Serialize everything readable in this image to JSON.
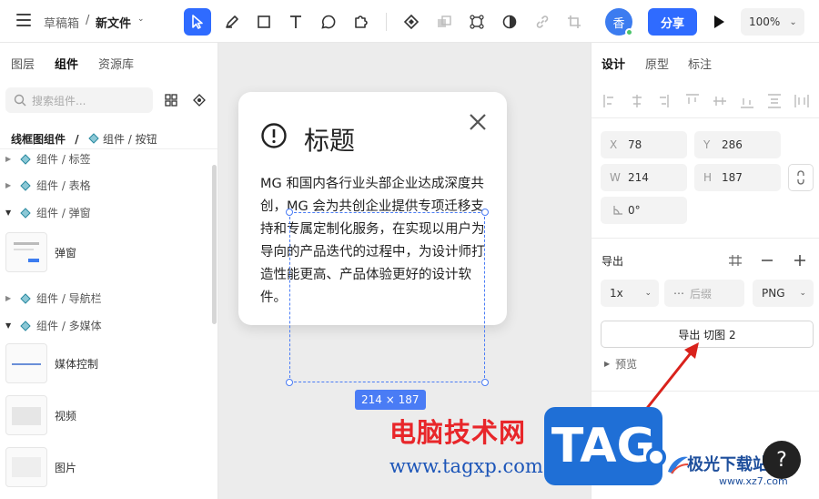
{
  "header": {
    "breadcrumb_folder": "草稿箱",
    "breadcrumb_sep": "/",
    "file_name": "新文件",
    "avatar_text": "香",
    "share_label": "分享",
    "zoom_value": "100%"
  },
  "tools": [
    "select-icon",
    "pen-icon",
    "rectangle-icon",
    "text-icon",
    "comment-icon",
    "plugin-icon",
    "component-icon",
    "boolean-icon",
    "frame-icon",
    "mask-icon",
    "link-icon",
    "crop-icon"
  ],
  "left_panel": {
    "tabs": [
      "图层",
      "组件",
      "资源库"
    ],
    "active_tab": "组件",
    "search_placeholder": "搜索组件...",
    "path_root": "线框图组件",
    "path_sep": "/",
    "path_current": "组件 / 按钮",
    "groups": [
      {
        "label": "组件 / 标签",
        "expanded": false
      },
      {
        "label": "组件 / 表格",
        "expanded": false
      },
      {
        "label": "组件 / 弹窗",
        "expanded": true
      },
      {
        "label": "组件 / 导航栏",
        "expanded": false
      },
      {
        "label": "组件 / 多媒体",
        "expanded": true
      }
    ],
    "components": [
      "弹窗",
      "媒体控制",
      "视频",
      "图片"
    ]
  },
  "canvas": {
    "card_title": "标题",
    "card_body": "MG 和国内各行业头部企业达成深度共创，MG 会为共创企业提供专项迁移支持和专属定制化服务，在实现以用户为导向的产品迭代的过程中，为设计师打造性能更高、产品体验更好的设计软件。",
    "selection_size": "214 × 187"
  },
  "right_panel": {
    "tabs": [
      "设计",
      "原型",
      "标注"
    ],
    "active_tab": "设计",
    "x": {
      "key": "X",
      "value": "78"
    },
    "y": {
      "key": "Y",
      "value": "286"
    },
    "w": {
      "key": "W",
      "value": "214"
    },
    "h": {
      "key": "H",
      "value": "187"
    },
    "rotation": "0°",
    "export_title": "导出",
    "export_scale": "1x",
    "export_suffix_placeholder": "后缀",
    "export_format": "PNG",
    "export_button": "导出 切图 2",
    "preview_label": "预览"
  },
  "watermarks": {
    "site_name": "电脑技术网",
    "site_url": "www.tagxp.com",
    "tag_text": "TAG",
    "brand": "极光下载站",
    "brand_url": "www.xz7.com"
  },
  "help_label": "?",
  "colors": {
    "accent": "#2f6bff",
    "selection": "#4a7cf5",
    "canvas": "#ececec"
  }
}
